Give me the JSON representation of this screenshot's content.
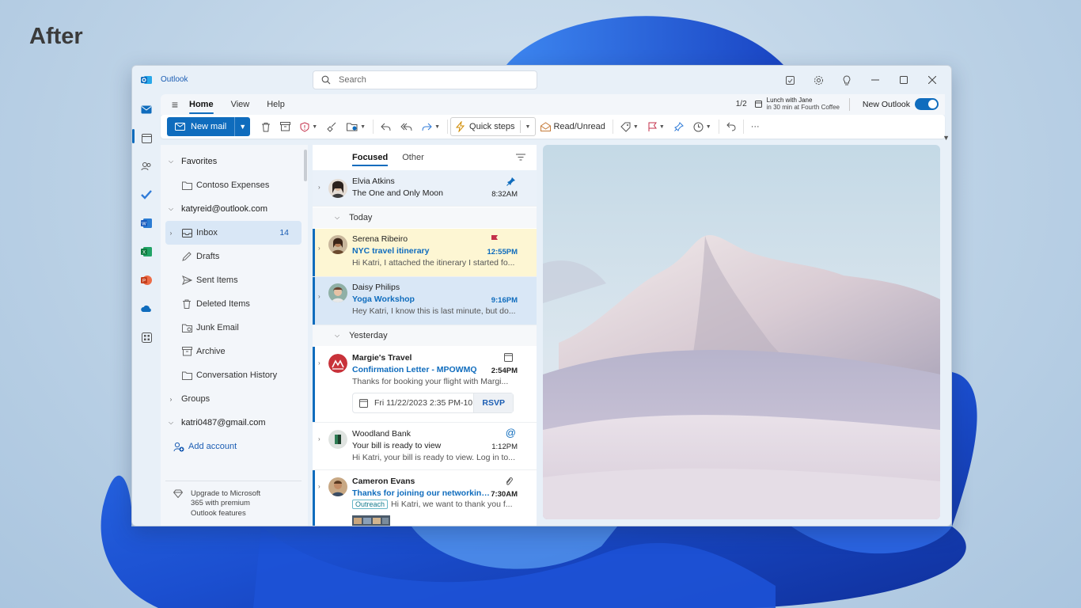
{
  "heading": "After",
  "app": {
    "name": "Outlook"
  },
  "search": {
    "placeholder": "Search"
  },
  "ribbon": {
    "tabs": [
      "Home",
      "View",
      "Help"
    ],
    "reminder_pages": "1/2",
    "reminder_title": "Lunch with Jane",
    "reminder_detail": "in 30 min at Fourth Coffee",
    "new_outlook_label": "New Outlook",
    "new_outlook_on": true
  },
  "toolbar": {
    "new_mail": "New mail",
    "quick_steps": "Quick steps",
    "read_unread": "Read/Unread",
    "more": "···"
  },
  "folders": {
    "favorites_label": "Favorites",
    "favorites": [
      "Contoso Expenses"
    ],
    "account1": "katyreid@outlook.com",
    "account1_folders": [
      {
        "name": "Inbox",
        "count": "14"
      },
      {
        "name": "Drafts"
      },
      {
        "name": "Sent Items"
      },
      {
        "name": "Deleted Items"
      },
      {
        "name": "Junk Email"
      },
      {
        "name": "Archive"
      },
      {
        "name": "Conversation History"
      }
    ],
    "groups": "Groups",
    "account2": "katri0487@gmail.com",
    "add_account": "Add account",
    "upgrade": [
      "Upgrade to Microsoft",
      "365 with premium",
      "Outlook features"
    ]
  },
  "message_list": {
    "tabs": [
      "Focused",
      "Other"
    ],
    "groups": [
      "Today",
      "Yesterday"
    ],
    "messages": [
      {
        "sender": "Elvia Atkins",
        "subject": "The One and Only Moon",
        "time": "8:32AM",
        "pinned": true
      },
      {
        "sender": "Serena Ribeiro",
        "subject": "NYC travel itinerary",
        "preview": "Hi Katri, I attached the itinerary I started fo...",
        "time": "12:55PM",
        "flagged": true
      },
      {
        "sender": "Daisy Philips",
        "subject": "Yoga Workshop",
        "preview": "Hey Katri, I know this is last minute, but do...",
        "time": "9:16PM"
      },
      {
        "sender": "Margie's Travel",
        "subject": "Confirmation Letter - MPOWMQ",
        "preview": "Thanks for booking your flight with Margi...",
        "time": "2:54PM",
        "event_date": "Fri 11/22/2023 2:35 PM-10",
        "rsvp": "RSVP"
      },
      {
        "sender": "Woodland Bank",
        "subject": "Your bill is ready to view",
        "preview": "Hi Katri, your bill is ready to view. Log in to...",
        "time": "1:12PM"
      },
      {
        "sender": "Cameron Evans",
        "subject": "Thanks for joining our networking...",
        "preview": "Hi Katri, we want to thank you f...",
        "time": "7:30AM",
        "tag": "Outreach"
      }
    ]
  },
  "colors": {
    "accent": "#0f6cbd",
    "flag": "#c4314b",
    "highlight_yellow": "#fdf6d3",
    "selected_blue": "#d9e7f6"
  }
}
